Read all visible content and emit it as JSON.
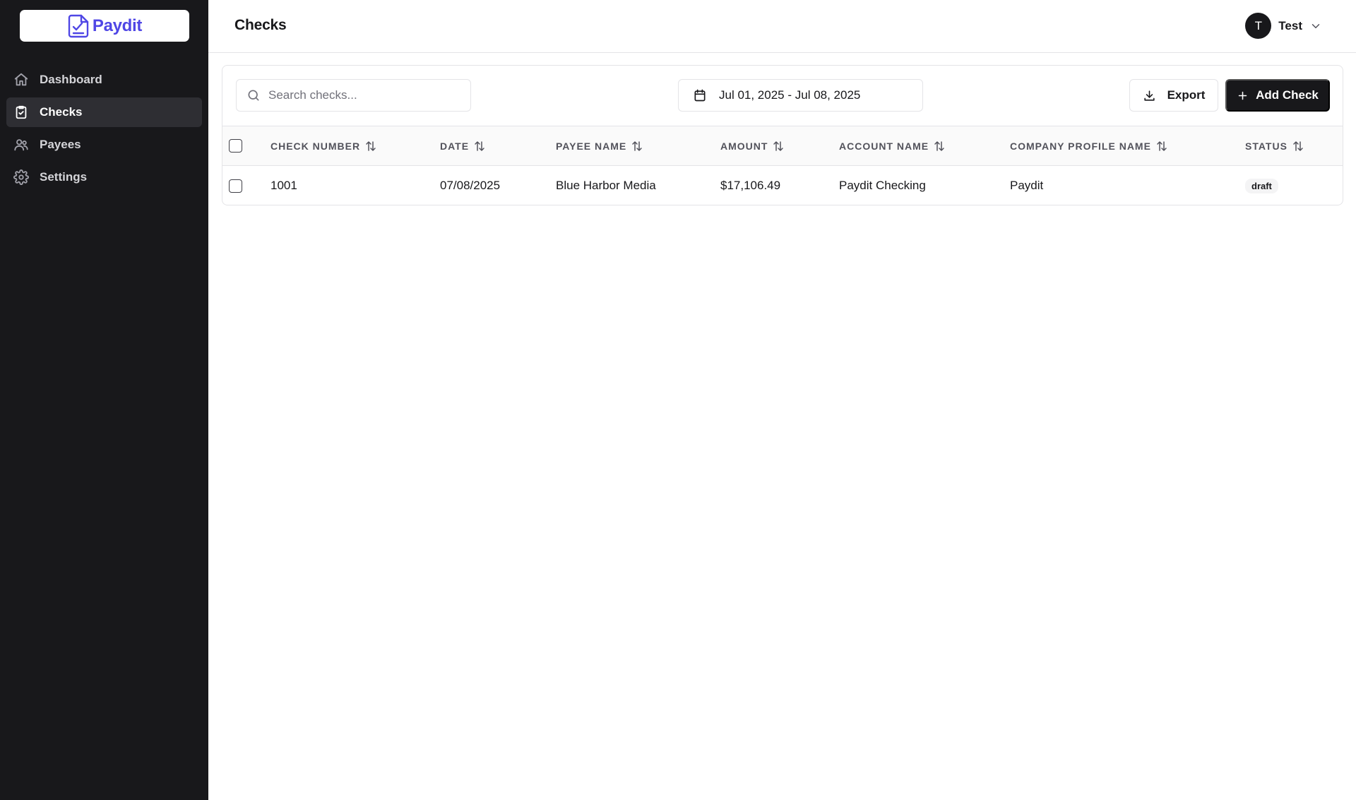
{
  "app": {
    "logo_text": "Paydit"
  },
  "sidebar": {
    "items": [
      {
        "label": "Dashboard",
        "icon": "home-icon",
        "active": false
      },
      {
        "label": "Checks",
        "icon": "clipboard-check-icon",
        "active": true
      },
      {
        "label": "Payees",
        "icon": "users-icon",
        "active": false
      },
      {
        "label": "Settings",
        "icon": "gear-icon",
        "active": false
      }
    ]
  },
  "header": {
    "title": "Checks",
    "user": {
      "initial": "T",
      "name": "Test"
    }
  },
  "toolbar": {
    "search_placeholder": "Search checks...",
    "date_range": "Jul 01, 2025 - Jul 08, 2025",
    "export_label": "Export",
    "add_label": "Add Check"
  },
  "table": {
    "columns": [
      {
        "label": "Check Number"
      },
      {
        "label": "Date"
      },
      {
        "label": "Payee Name"
      },
      {
        "label": "Amount"
      },
      {
        "label": "Account Name"
      },
      {
        "label": "Company Profile Name"
      },
      {
        "label": "Status"
      }
    ],
    "rows": [
      {
        "check_number": "1001",
        "date": "07/08/2025",
        "payee_name": "Blue Harbor Media",
        "amount": "$17,106.49",
        "account_name": "Paydit Checking",
        "company_profile_name": "Paydit",
        "status": "draft"
      }
    ]
  },
  "colors": {
    "sidebar_bg": "#18181b",
    "brand": "#4f46e5",
    "primary_button": "#18181b"
  }
}
